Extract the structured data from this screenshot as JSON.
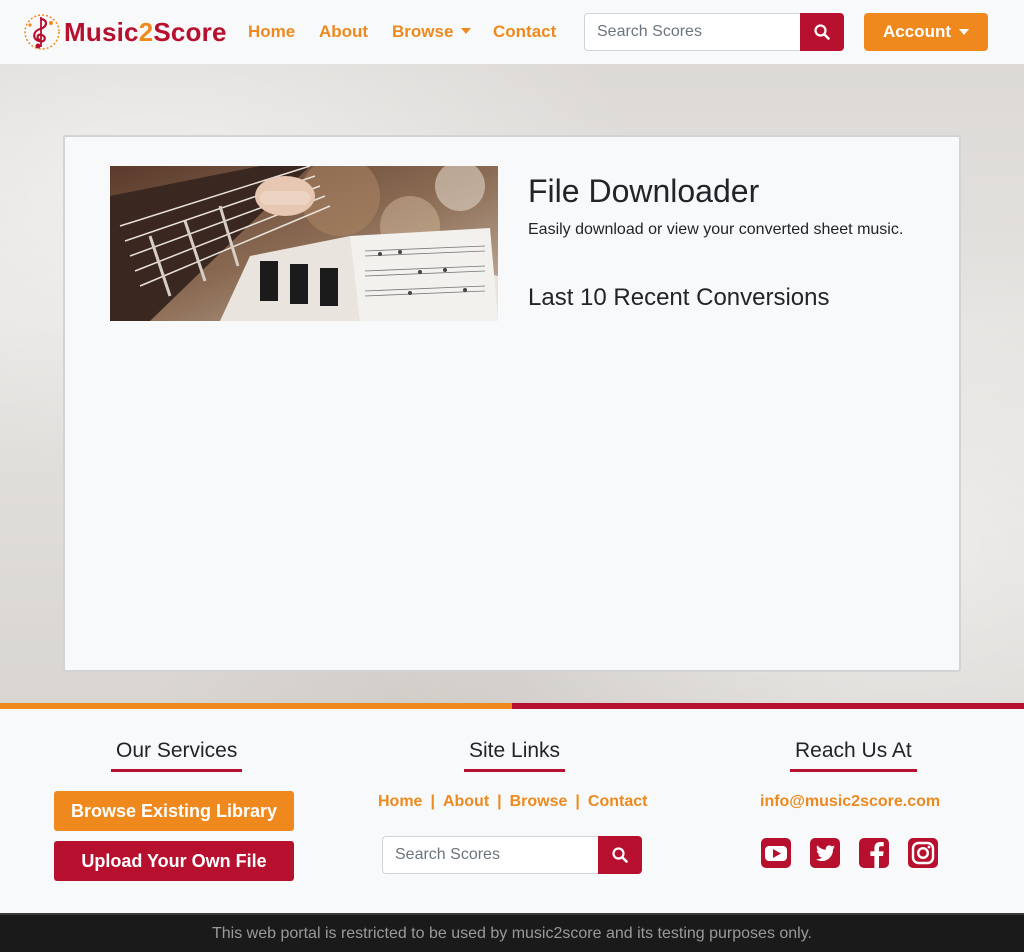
{
  "brand": {
    "name_part1": "Music",
    "name_part2": "2",
    "name_part3": "Score"
  },
  "nav": {
    "home": "Home",
    "about": "About",
    "browse": "Browse",
    "contact": "Contact",
    "search_placeholder": "Search Scores",
    "account": "Account"
  },
  "main": {
    "title": "File Downloader",
    "subtitle": "Easily download or view your converted sheet music.",
    "recent_heading": "Last 10 Recent Conversions"
  },
  "footer": {
    "services_heading": "Our Services",
    "browse_library": "Browse Existing Library",
    "upload_file": "Upload Your Own File",
    "links_heading": "Site Links",
    "links": [
      "Home",
      "About",
      "Browse",
      "Contact"
    ],
    "search_placeholder": "Search Scores",
    "reach_heading": "Reach Us At",
    "email": "info@music2score.com",
    "social_icons": [
      "youtube-icon",
      "twitter-icon",
      "facebook-icon",
      "instagram-icon"
    ]
  },
  "legal": "This web portal is restricted to be used by music2score and its testing purposes only.",
  "colors": {
    "accent": "#f0891d",
    "brand": "#b7102f",
    "link": "#ec8a1f"
  }
}
